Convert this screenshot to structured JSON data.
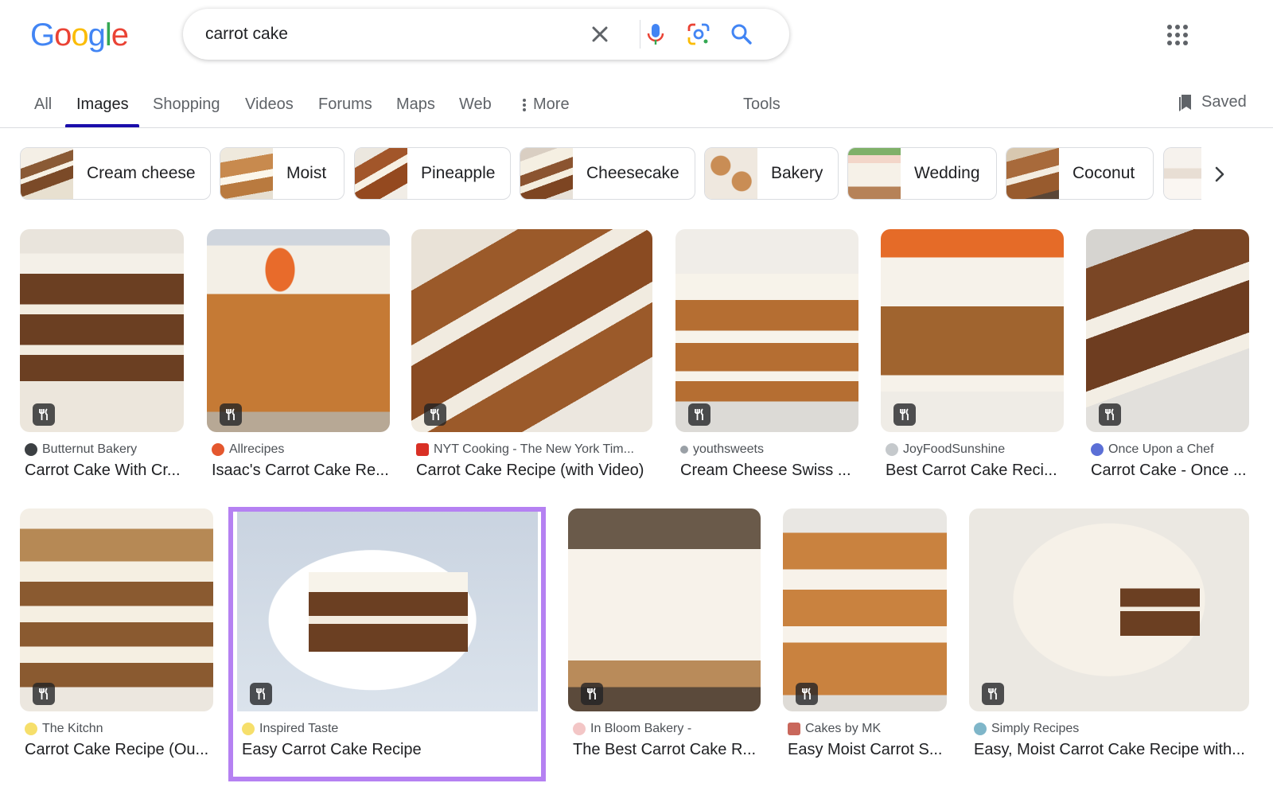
{
  "logo": {
    "letters": [
      "G",
      "o",
      "o",
      "g",
      "l",
      "e"
    ],
    "colors": [
      "#4285F4",
      "#EA4335",
      "#FBBC05",
      "#4285F4",
      "#34A853",
      "#EA4335"
    ]
  },
  "search": {
    "query": "carrot cake"
  },
  "icons": {
    "clear": "close-icon",
    "voice": "mic-icon",
    "lens": "lens-icon",
    "search": "search-icon",
    "apps": "apps-grid-icon",
    "saved": "bookmark-icon",
    "more": "vertical-dots-icon",
    "recipe": "utensils-icon",
    "next": "chevron-right-icon"
  },
  "tabs": [
    {
      "label": "All"
    },
    {
      "label": "Images"
    },
    {
      "label": "Shopping"
    },
    {
      "label": "Videos"
    },
    {
      "label": "Forums"
    },
    {
      "label": "Maps"
    },
    {
      "label": "Web"
    },
    {
      "label": "More"
    },
    {
      "label": "Tools"
    }
  ],
  "active_tab": "Images",
  "saved_label": "Saved",
  "chips": [
    {
      "label": "Cream cheese"
    },
    {
      "label": "Moist"
    },
    {
      "label": "Pineapple"
    },
    {
      "label": "Cheesecake"
    },
    {
      "label": "Bakery"
    },
    {
      "label": "Wedding"
    },
    {
      "label": "Coconut"
    }
  ],
  "results_row1": [
    {
      "source": "Butternut Bakery",
      "title": "Carrot Cake With Cr..."
    },
    {
      "source": "Allrecipes",
      "title": "Isaac's Carrot Cake Re..."
    },
    {
      "source": "NYT Cooking - The New York Tim...",
      "title": "Carrot Cake Recipe (with Video)"
    },
    {
      "source": "youthsweets",
      "title": "Cream Cheese Swiss ..."
    },
    {
      "source": "JoyFoodSunshine",
      "title": "Best Carrot Cake Reci..."
    },
    {
      "source": "Once Upon a Chef",
      "title": "Carrot Cake - Once ..."
    }
  ],
  "results_row2": [
    {
      "source": "The Kitchn",
      "title": "Carrot Cake Recipe (Ou..."
    },
    {
      "source": "Inspired Taste",
      "title": "Easy Carrot Cake Recipe",
      "highlighted": true
    },
    {
      "source": "In Bloom Bakery -",
      "title": "The Best Carrot Cake R..."
    },
    {
      "source": "Cakes by MK",
      "title": "Easy Moist Carrot S..."
    },
    {
      "source": "Simply Recipes",
      "title": "Easy, Moist Carrot Cake Recipe with..."
    }
  ],
  "colors": {
    "highlight": "#b581f2",
    "tab_underline": "#1a0dab"
  }
}
